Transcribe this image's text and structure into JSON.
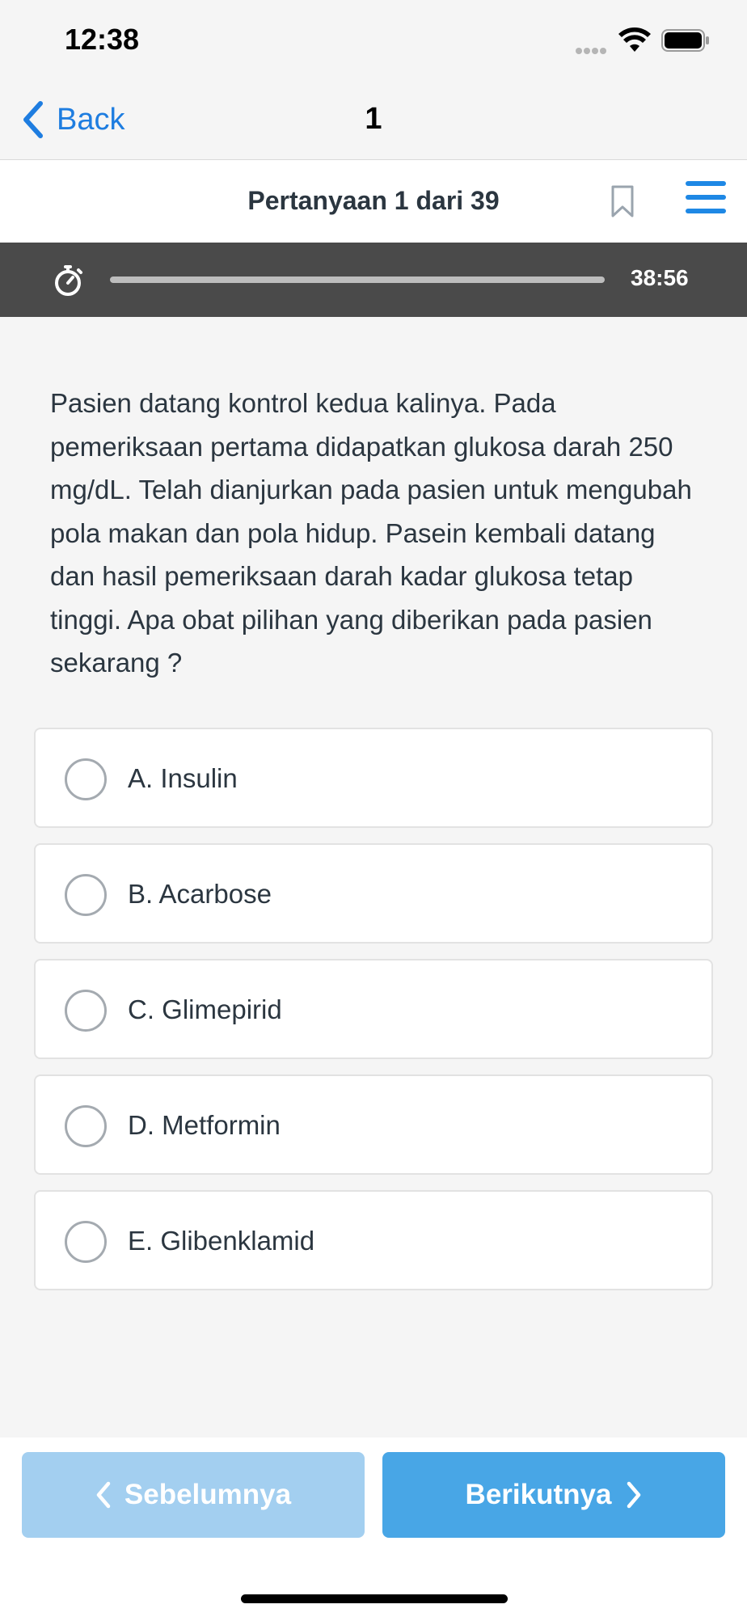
{
  "status_bar": {
    "time": "12:38",
    "icons": [
      "signal-dots-icon",
      "wifi-icon",
      "battery-icon"
    ]
  },
  "nav": {
    "back_label": "Back",
    "title": "1",
    "back_icon": "chevron-left-icon"
  },
  "header": {
    "counter": "Pertanyaan 1 dari 39",
    "bookmark_icon": "bookmark-icon",
    "menu_icon": "hamburger-menu-icon"
  },
  "timer": {
    "time_left": "38:56",
    "progress": 1.0,
    "icon": "stopwatch-icon"
  },
  "question": {
    "text": "Pasien datang kontrol kedua kalinya. Pada pemeriksaan pertama didapatkan glukosa darah 250 mg/dL. Telah dianjurkan pada pasien untuk mengubah pola makan dan pola hidup. Pasein kembali datang dan hasil pemeriksaan darah kadar glukosa tetap tinggi. Apa obat pilihan yang diberikan pada pasien sekarang ?"
  },
  "options": [
    {
      "label": "A. Insulin",
      "selected": false
    },
    {
      "label": "B. Acarbose",
      "selected": false
    },
    {
      "label": "C. Glimepirid",
      "selected": false
    },
    {
      "label": "D. Metformin",
      "selected": false
    },
    {
      "label": "E. Glibenklamid",
      "selected": false
    }
  ],
  "footer": {
    "prev_label": "Sebelumnya",
    "next_label": "Berikutnya",
    "prev_enabled": false
  },
  "colors": {
    "accent": "#1e88e5",
    "next_button": "#48a6e6",
    "prev_button_disabled": "#a3cff0",
    "timer_bar": "#4a4a4a"
  }
}
